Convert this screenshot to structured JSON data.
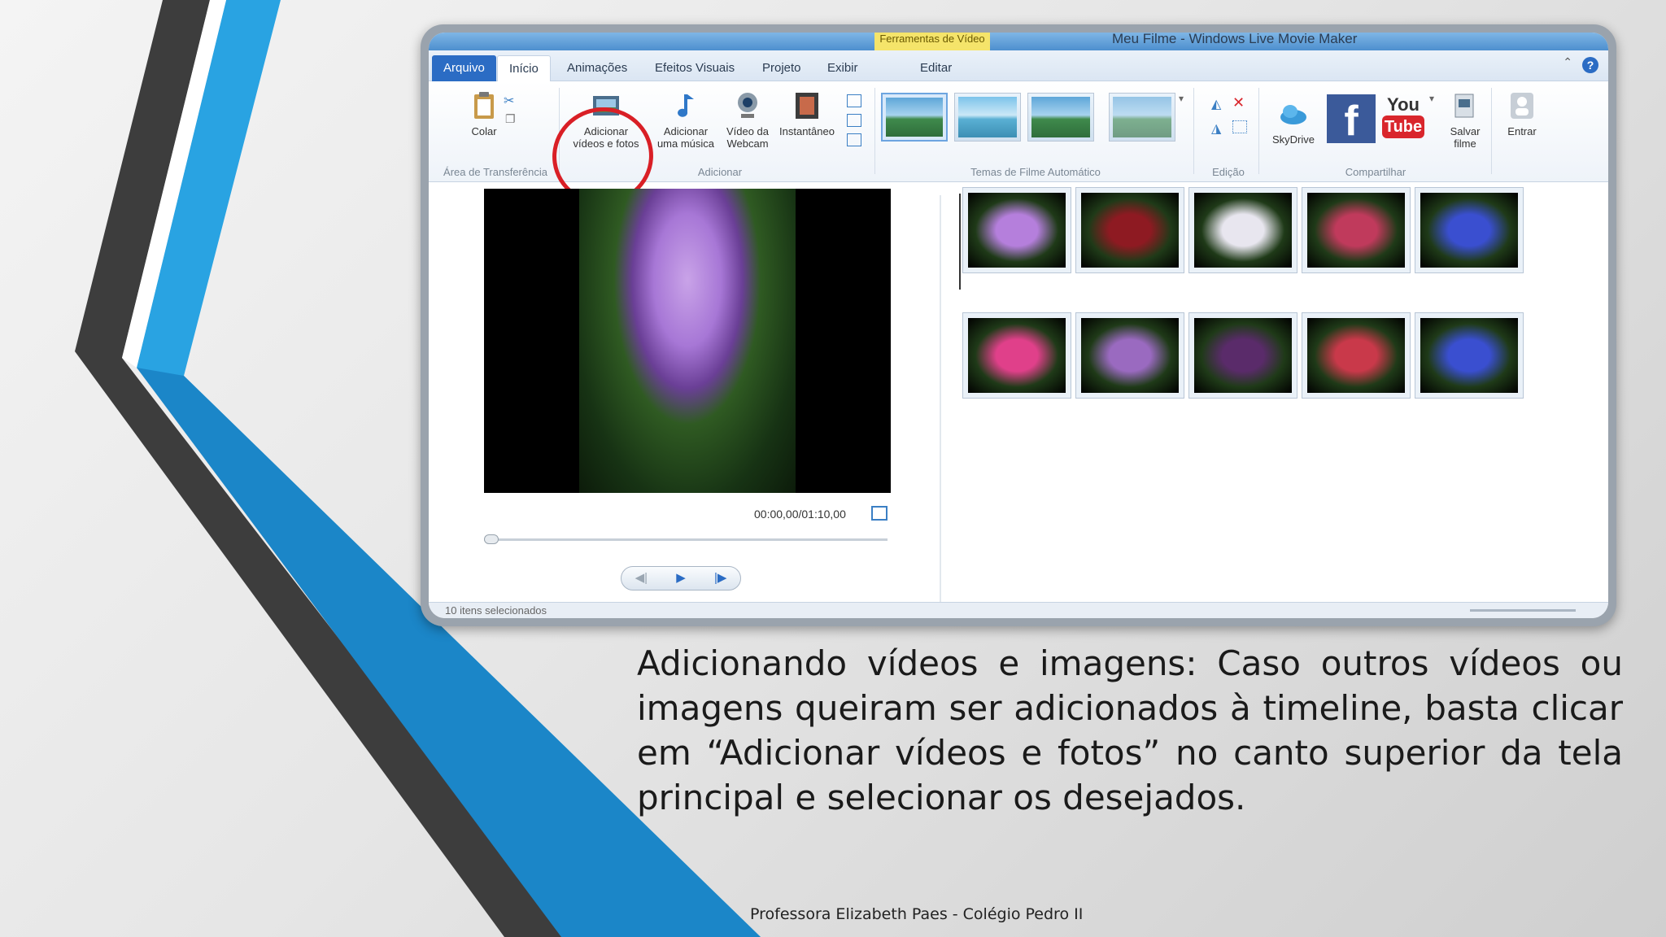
{
  "app": {
    "window_title": "Meu Filme - Windows Live Movie Maker",
    "contextual_header": "Ferramentas de Vídeo",
    "tabs": [
      {
        "label": "Arquivo"
      },
      {
        "label": "Início"
      },
      {
        "label": "Animações"
      },
      {
        "label": "Efeitos Visuais"
      },
      {
        "label": "Projeto"
      },
      {
        "label": "Exibir"
      },
      {
        "label": "Editar"
      }
    ],
    "help_label": "?",
    "ribbon": {
      "clipboard": {
        "paste_label": "Colar",
        "group_label": "Área de Transferência"
      },
      "add": {
        "add_videos_line1": "Adicionar",
        "add_videos_line2": "vídeos e fotos",
        "add_music_line1": "Adicionar",
        "add_music_line2": "uma música",
        "webcam_line1": "Vídeo da",
        "webcam_line2": "Webcam",
        "snapshot_label": "Instantâneo",
        "group_label": "Adicionar"
      },
      "themes": {
        "group_label": "Temas de Filme Automático"
      },
      "editing": {
        "group_label": "Edição"
      },
      "share": {
        "skydrive_label": "SkyDrive",
        "facebook_label": "f",
        "youtube_you": "You",
        "youtube_tube": "Tube",
        "save_line1": "Salvar",
        "save_line2": "filme",
        "group_label": "Compartilhar"
      },
      "signin_label": "Entrar"
    },
    "preview": {
      "time": "00:00,00/01:10,00",
      "transport": {
        "prev": "◀|",
        "play": "▶",
        "next": "|▶"
      }
    },
    "statusbar": "10 itens selecionados",
    "clips": [
      {
        "color": "#b57fdc"
      },
      {
        "color": "#8e1a22"
      },
      {
        "color": "#e8e6ef"
      },
      {
        "color": "#c03a5c"
      },
      {
        "color": "#3a4fd0"
      },
      {
        "color": "#e0408a"
      },
      {
        "color": "#9a6ac0"
      },
      {
        "color": "#5a2b6a"
      },
      {
        "color": "#c9394a"
      },
      {
        "color": "#3a4fd0"
      }
    ]
  },
  "caption": "Adicionando vídeos e imagens: Caso outros vídeos ou imagens queiram ser adicionados à timeline, basta clicar em “Adicionar vídeos e fotos” no canto superior da tela principal e selecionar os desejados.",
  "footer": "Professora Elizabeth Paes - Colégio Pedro II"
}
